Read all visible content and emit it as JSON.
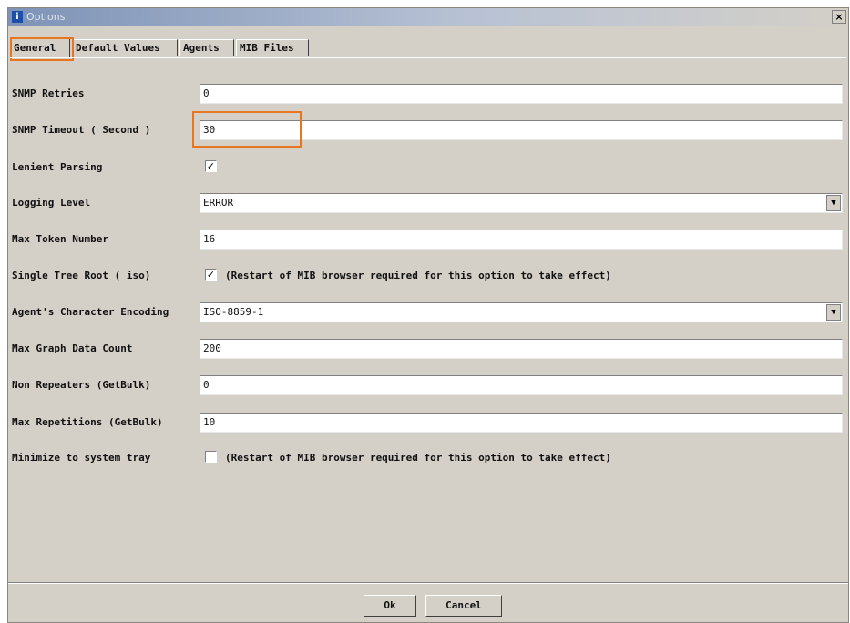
{
  "window": {
    "title": "Options",
    "close_glyph": "×"
  },
  "tabs": [
    {
      "label": "General",
      "active": true
    },
    {
      "label": "Default Values",
      "active": false
    },
    {
      "label": "Agents",
      "active": false
    },
    {
      "label": "MIB Files",
      "active": false
    }
  ],
  "fields": {
    "snmp_retries": {
      "label": "SNMP Retries",
      "value": "0"
    },
    "snmp_timeout": {
      "label": "SNMP Timeout ( Second )",
      "value": "30"
    },
    "lenient_parsing": {
      "label": "Lenient Parsing",
      "checked": true
    },
    "logging_level": {
      "label": "Logging Level",
      "value": "ERROR"
    },
    "max_token_number": {
      "label": "Max Token Number",
      "value": "16"
    },
    "single_tree_root": {
      "label": "Single Tree Root ( iso)",
      "checked": true,
      "note": "(Restart of MIB browser required for this option to take effect)"
    },
    "agent_encoding": {
      "label": "Agent's Character Encoding",
      "value": "ISO-8859-1"
    },
    "max_graph_data_count": {
      "label": "Max Graph Data Count",
      "value": "200"
    },
    "non_repeaters": {
      "label": "Non Repeaters (GetBulk)",
      "value": "0"
    },
    "max_repetitions": {
      "label": "Max Repetitions (GetBulk)",
      "value": "10"
    },
    "minimize_tray": {
      "label": "Minimize to system tray",
      "checked": false,
      "note": "(Restart of MIB browser required for this option to take effect)"
    }
  },
  "buttons": {
    "ok": "Ok",
    "cancel": "Cancel"
  },
  "icons": {
    "app": "info-icon",
    "close": "close-icon",
    "dropdown": "chevron-down-icon",
    "check": "check-icon"
  },
  "colors": {
    "highlight": "#e8761e",
    "window_bg": "#d4d0c8",
    "titlebar": "#7d93b7"
  }
}
